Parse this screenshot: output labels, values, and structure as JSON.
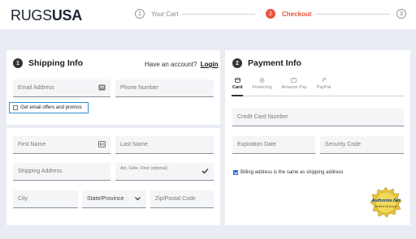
{
  "logo": {
    "part1": "RUGS",
    "part2": "USA"
  },
  "steps": [
    {
      "num": "1",
      "label": "Your Cart"
    },
    {
      "num": "2",
      "label": "Checkout"
    },
    {
      "num": "3",
      "label": ""
    }
  ],
  "shipping": {
    "badge": "1",
    "title": "Shipping Info",
    "account_prompt": "Have an account?",
    "login_label": "Login",
    "email_placeholder": "Email Address",
    "phone_placeholder": "Phone Number",
    "optin_label": "Get email offers and promos",
    "first_name_placeholder": "First Name",
    "last_name_placeholder": "Last Name",
    "address_placeholder": "Shipping Address",
    "address2_placeholder": "Apt, Suite, Floor (optional)",
    "city_placeholder": "City",
    "state_placeholder": "State/Province",
    "zip_placeholder": "Zip/Postal Code"
  },
  "payment": {
    "badge": "2",
    "title": "Payment Info",
    "tabs": [
      {
        "label": "Card",
        "icon": "card-icon"
      },
      {
        "label": "Financing",
        "icon": "financing-icon"
      },
      {
        "label": "Amazon Pay",
        "icon": "amazon-pay-icon"
      },
      {
        "label": "PayPal",
        "icon": "paypal-icon"
      }
    ],
    "card_placeholder": "Credit Card Number",
    "expiry_placeholder": "Expiration Date",
    "security_placeholder": "Security Code",
    "billing_same_label": "Billing address is the same as shipping address",
    "billing_same_checked": true
  },
  "seal": {
    "brand": "Authorize.Net",
    "sub": "Verified Merchant"
  },
  "colors": {
    "accent": "#e8543e",
    "focus": "#2c8fd1",
    "check": "#2f6fd6"
  }
}
